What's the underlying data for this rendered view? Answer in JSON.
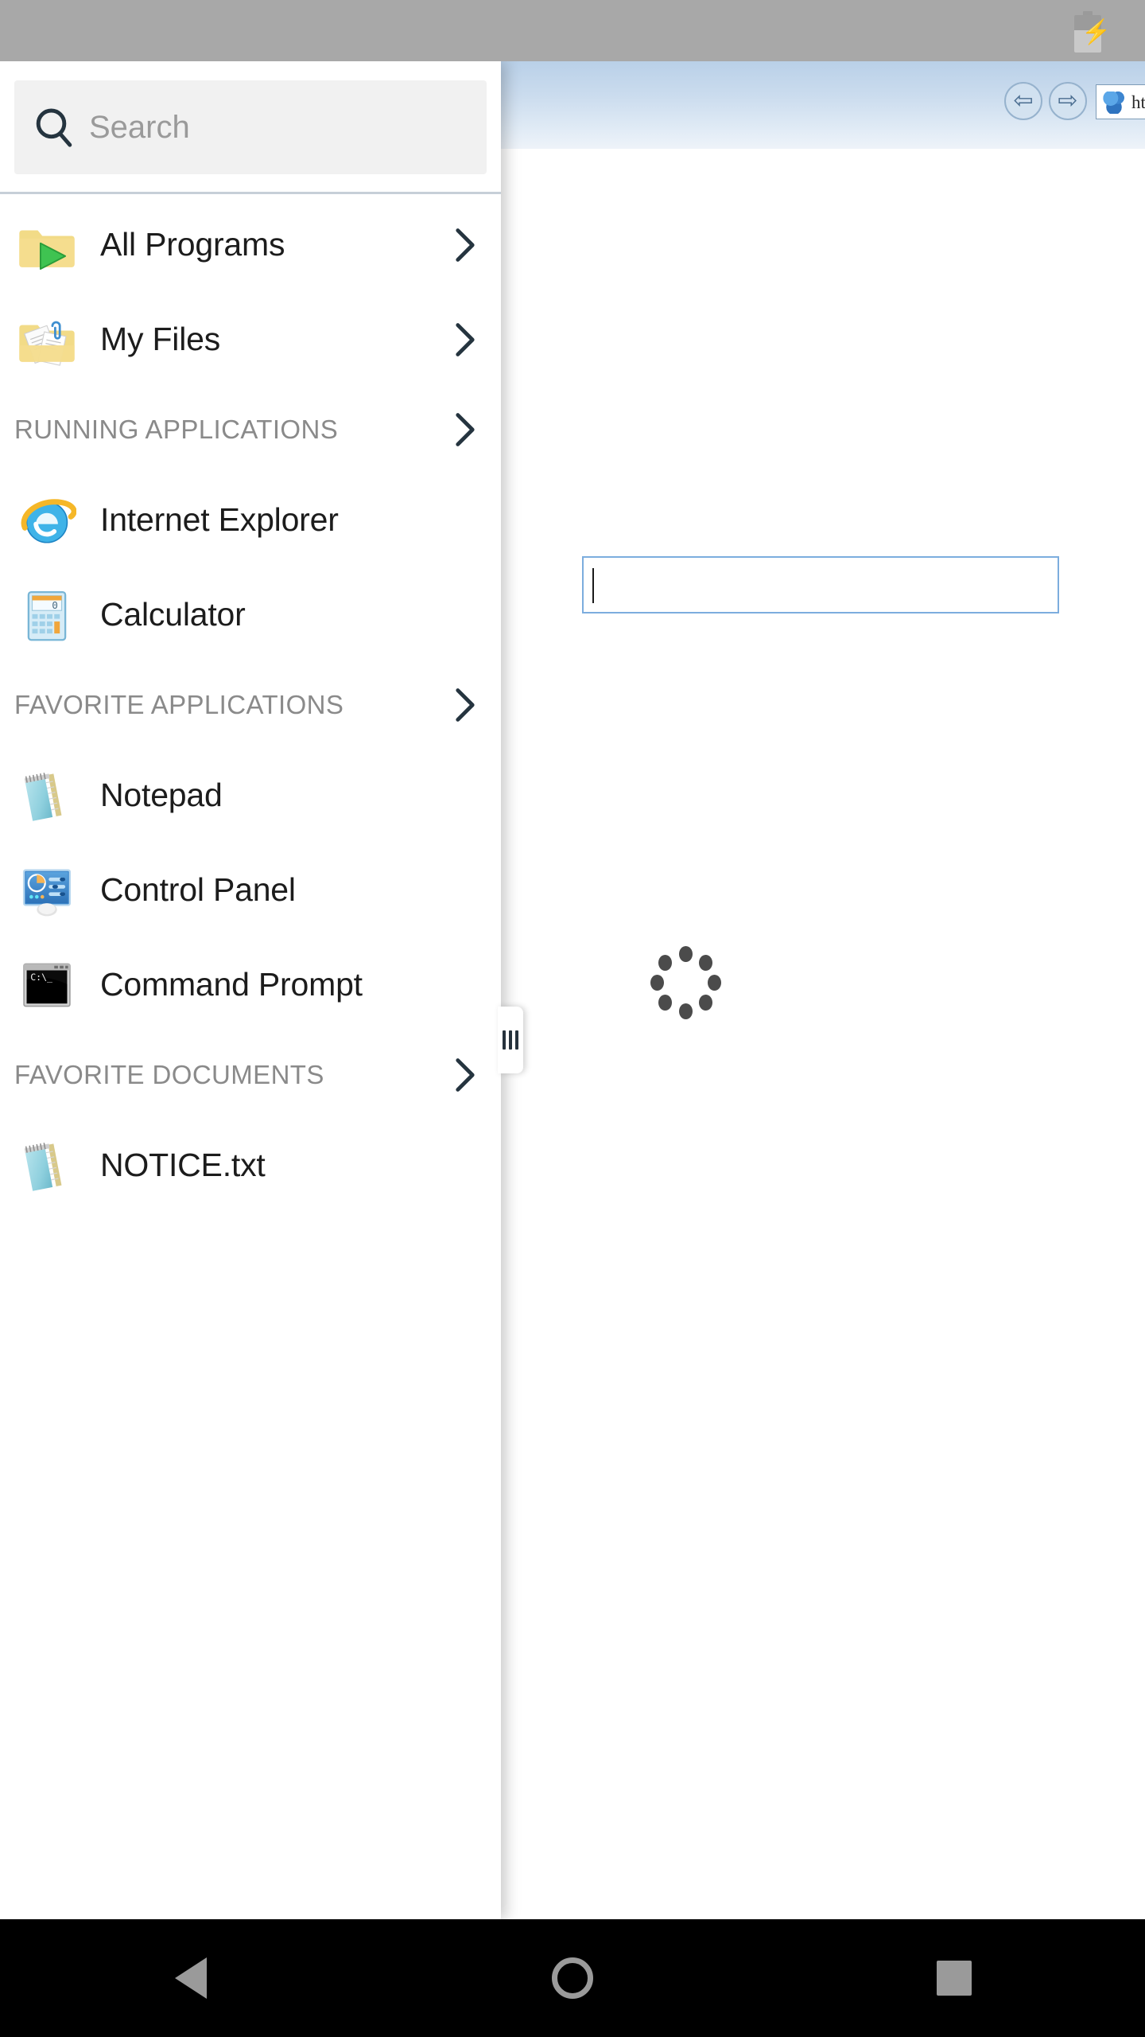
{
  "statusbar": {
    "battery_icon": "battery-charging-icon"
  },
  "browser": {
    "back_icon": "back-arrow-icon",
    "forward_icon": "forward-arrow-icon",
    "favicon": "baidu-paw-icon",
    "url": "http://www.baidu.co",
    "input_value": "",
    "spinner_icon": "loading-spinner-icon"
  },
  "drawer": {
    "search": {
      "placeholder": "Search",
      "value": "",
      "icon": "search-icon"
    },
    "top_items": [
      {
        "label": "All Programs",
        "icon": "folder-programs-icon",
        "chevron": "chevron-right-icon"
      },
      {
        "label": "My Files",
        "icon": "folder-documents-icon",
        "chevron": "chevron-right-icon"
      }
    ],
    "sections": [
      {
        "title": "RUNNING APPLICATIONS",
        "chevron": "chevron-right-icon",
        "items": [
          {
            "label": "Internet Explorer",
            "icon": "internet-explorer-icon"
          },
          {
            "label": "Calculator",
            "icon": "calculator-icon"
          }
        ]
      },
      {
        "title": "FAVORITE APPLICATIONS",
        "chevron": "chevron-right-icon",
        "items": [
          {
            "label": "Notepad",
            "icon": "notepad-icon"
          },
          {
            "label": "Control Panel",
            "icon": "control-panel-icon"
          },
          {
            "label": "Command Prompt",
            "icon": "command-prompt-icon"
          }
        ]
      },
      {
        "title": "FAVORITE DOCUMENTS",
        "chevron": "chevron-right-icon",
        "items": [
          {
            "label": "NOTICE.txt",
            "icon": "notepad-document-icon"
          }
        ]
      }
    ],
    "handle_icon": "drawer-grip-handle-icon"
  },
  "navbar": {
    "back_icon": "android-back-icon",
    "home_icon": "android-home-icon",
    "recents_icon": "android-recents-icon"
  },
  "colors": {
    "statusbar": "#a8a8a8",
    "accent_blue": "#7cadde",
    "text_primary": "#1c1c1c",
    "text_muted": "#8a8a8a",
    "search_bg": "#f1f1f1"
  }
}
